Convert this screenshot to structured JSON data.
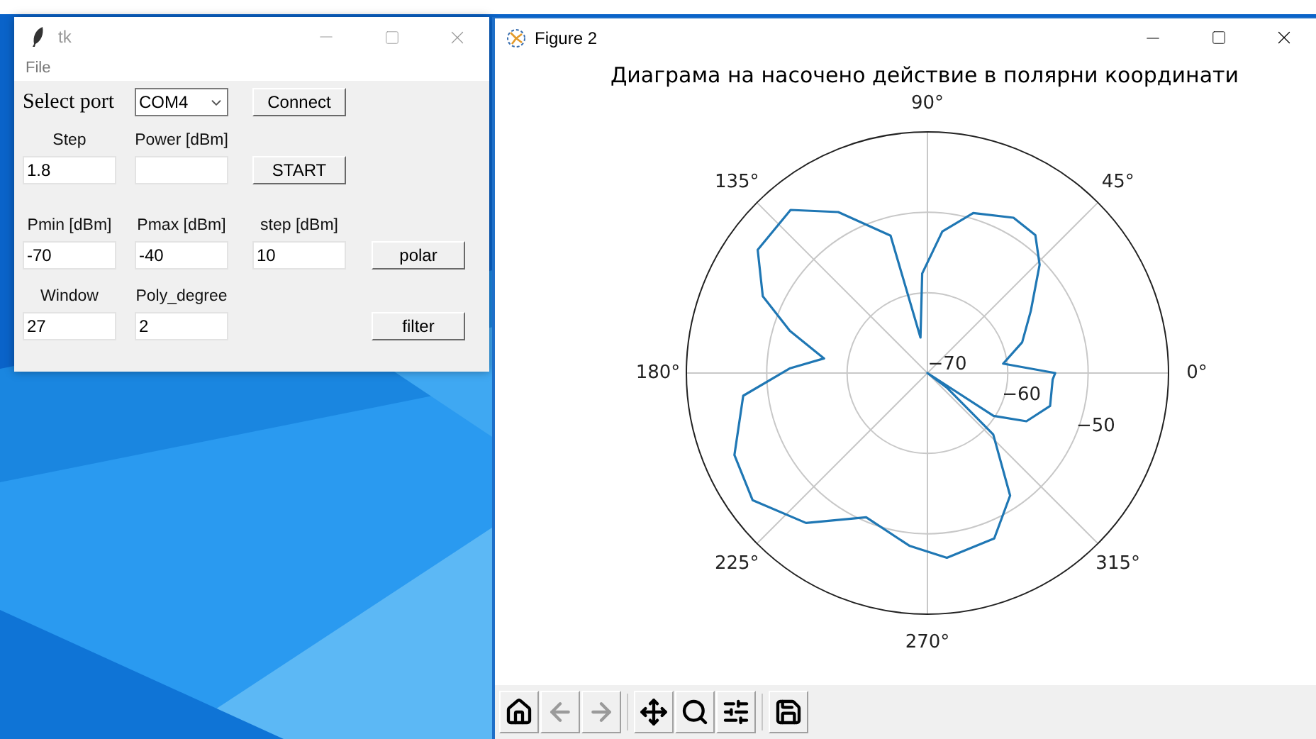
{
  "tk_window": {
    "title": "tk",
    "menu": [
      "File"
    ],
    "port_row": {
      "label": "Select port",
      "port": "COM4",
      "button": "Connect"
    },
    "rows": [
      {
        "cells": [
          {
            "kind": "field",
            "label": "Step",
            "value": "1.8"
          },
          {
            "kind": "field",
            "label": "Power [dBm]"
          },
          {
            "kind": "button",
            "text": "START"
          }
        ]
      },
      {
        "cells": [
          {
            "kind": "field",
            "label": "Pmin [dBm]",
            "value": "-70"
          },
          {
            "kind": "field",
            "label": "Pmax [dBm]",
            "value": "-40"
          },
          {
            "kind": "field",
            "label": "step [dBm]",
            "value": "10"
          },
          {
            "kind": "button",
            "text": "polar"
          }
        ]
      },
      {
        "cells": [
          {
            "kind": "field",
            "label": "Window",
            "value": "27"
          },
          {
            "kind": "field",
            "label": "Poly_degree",
            "value": "2"
          },
          {
            "kind": "spacer"
          },
          {
            "kind": "button",
            "text": "filter"
          }
        ]
      }
    ]
  },
  "figure_window": {
    "title": "Figure 2",
    "plot_title": "Диаграма на насочено действие в полярни координати",
    "angle_labels": [
      "0°",
      "45°",
      "90°",
      "135°",
      "180°",
      "225°",
      "270°",
      "315°"
    ],
    "radial_labels": [
      "−70",
      "−60",
      "−50"
    ],
    "toolbar": [
      {
        "kind": "home",
        "disabled": false
      },
      {
        "kind": "back",
        "disabled": true
      },
      {
        "kind": "forward",
        "disabled": true
      },
      {
        "kind": "separator"
      },
      {
        "kind": "pan",
        "disabled": false
      },
      {
        "kind": "zoom",
        "disabled": false
      },
      {
        "kind": "configure",
        "disabled": false
      },
      {
        "kind": "separator"
      },
      {
        "kind": "save",
        "disabled": false
      }
    ]
  }
}
